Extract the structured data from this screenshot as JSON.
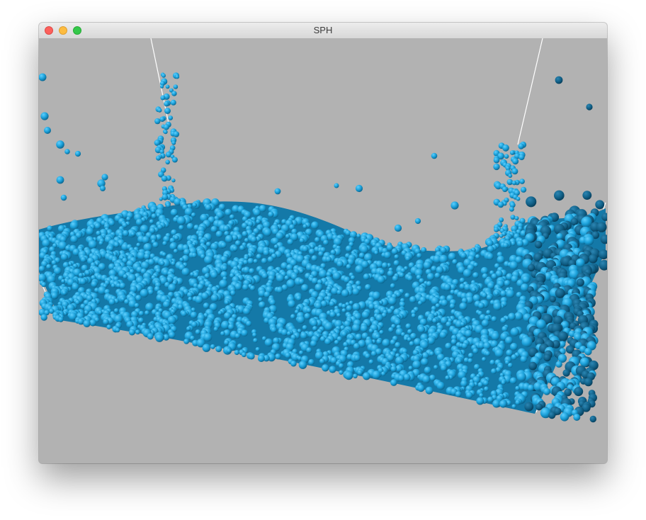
{
  "window": {
    "title": "SPH",
    "controls": [
      "close",
      "minimize",
      "zoom"
    ]
  },
  "scene": {
    "background_color": "#b2b2b2",
    "particle_color": "#1a9fd8",
    "particle_shadow_color": "#0a5f87",
    "particle_highlight_color": "#5fd0ff",
    "container_line_color": "#ffffff"
  }
}
